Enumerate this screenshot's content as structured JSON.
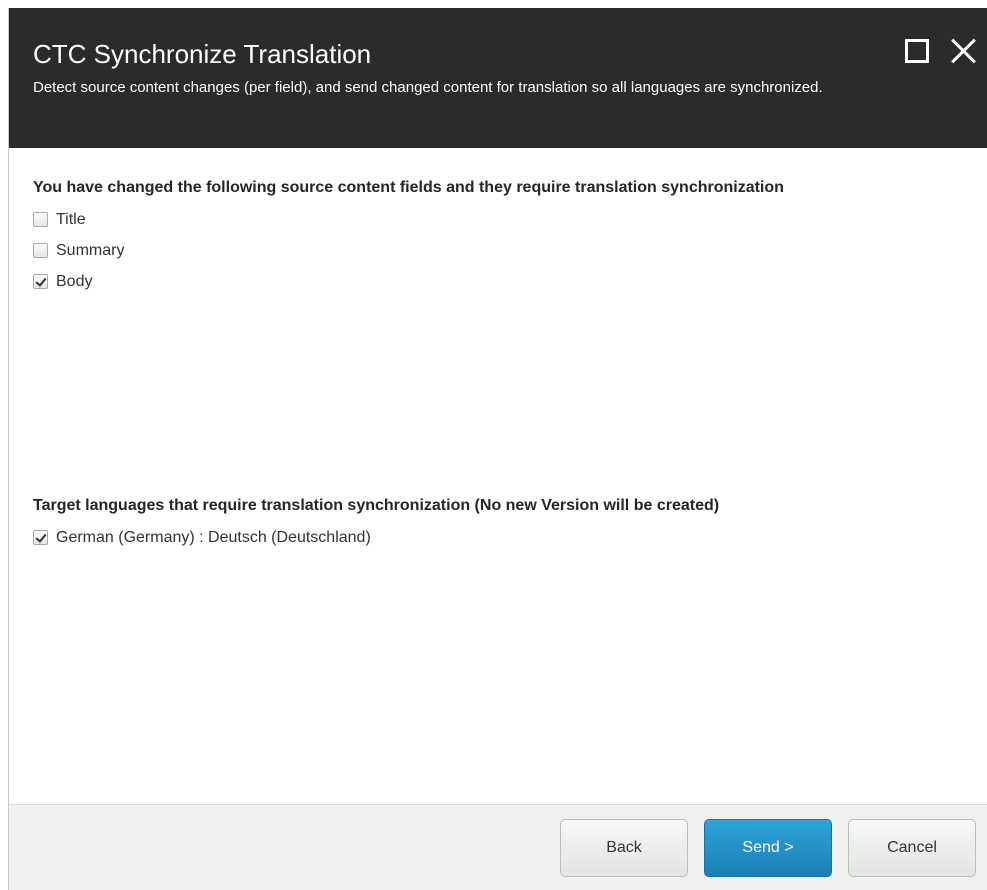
{
  "dialog": {
    "title": "CTC Synchronize Translation",
    "subtitle": "Detect source content changes (per field), and send changed content for translation so all languages are synchronized."
  },
  "source_fields": {
    "heading": "You have changed the following source content fields and they require translation synchronization",
    "items": [
      {
        "label": "Title",
        "checked": false
      },
      {
        "label": "Summary",
        "checked": false
      },
      {
        "label": "Body",
        "checked": true
      }
    ]
  },
  "target_languages": {
    "heading": "Target languages that require translation synchronization (No new Version will be created)",
    "items": [
      {
        "label": "German (Germany) : Deutsch (Deutschland)",
        "checked": true
      }
    ]
  },
  "footer": {
    "back_label": "Back",
    "send_label": "Send >",
    "cancel_label": "Cancel"
  },
  "colors": {
    "header_bg": "#2b2b2b",
    "primary_button": "#1f8ec6",
    "footer_bg": "#f0f0f0"
  },
  "icons": {
    "maximize": "maximize-icon",
    "close": "close-icon",
    "checkbox": "checkbox-icon"
  }
}
